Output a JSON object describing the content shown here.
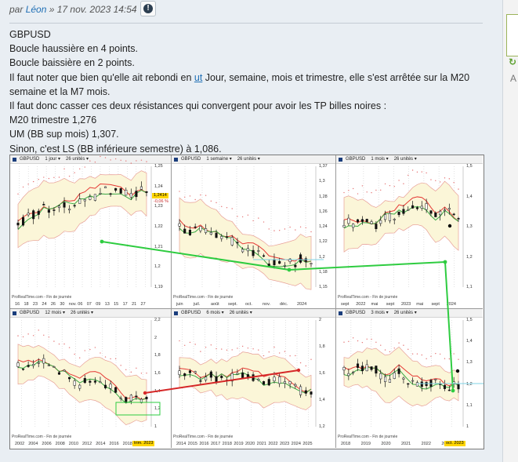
{
  "post": {
    "by": "par",
    "author": "Léon",
    "datetime": "» 17 nov. 2023 14:54",
    "report_icon": "exclamation-icon",
    "lines": {
      "l1": "GBPUSD",
      "l2": "Boucle haussière en 4 points.",
      "l3": "Boucle baissière en 2 points.",
      "l4_pre": "Il faut noter que bien qu'elle ait rebondi en ",
      "l4_link": "ut",
      "l4_post": " Jour, semaine, mois et trimestre, elle s'est arrêtée sur la M20",
      "l5": "semaine et la M7 mois.",
      "l6": "Il faut donc casser ces deux résistances qui convergent pour avoir les TP billes noires :",
      "l7": "M20 trimestre 1,276",
      "l8": "UM (BB sup mois) 1,307.",
      "l9": "Sinon, c'est LS (BB inférieure semestre) à 1,086."
    }
  },
  "charts": {
    "source": "ProRealTime.com - Fin de journée",
    "panels": [
      {
        "symbol": "GBPUSD",
        "tf": "1 jour",
        "units": "26 unités",
        "x": [
          "16",
          "18",
          "23",
          "24",
          "26",
          "30",
          "nov.",
          "06",
          "07",
          "09",
          "13",
          "15",
          "17",
          "21",
          "27"
        ],
        "y": [
          "1,25",
          "1,24",
          "1,23",
          "1,22",
          "1,21",
          "1,2",
          "1,19"
        ],
        "tag1": "1,2414",
        "tag2": "-0,06 %"
      },
      {
        "symbol": "GBPUSD",
        "tf": "1 semaine",
        "units": "26 unités",
        "x": [
          "juin",
          "juil.",
          "août",
          "sept.",
          "oct.",
          "nov.",
          "déc.",
          "2024"
        ],
        "y": [
          "1,37",
          "1,3",
          "1,28",
          "1,26",
          "1,24",
          "1,22",
          "1,2",
          "1,18",
          "1,15"
        ]
      },
      {
        "symbol": "GBPUSD",
        "tf": "1 mois",
        "units": "26 unités",
        "x": [
          "sept",
          "2022",
          "mai",
          "sept",
          "2023",
          "mai",
          "sept",
          "2024"
        ],
        "y": [
          "1,5",
          "1,4",
          "1,3",
          "1,2",
          "1,1"
        ]
      },
      {
        "symbol": "GBPUSD",
        "tf": "12 mois",
        "units": "26 unités",
        "x": [
          "2002",
          "2004",
          "2006",
          "2008",
          "2010",
          "2012",
          "2014",
          "2016",
          "2018",
          "2020"
        ],
        "y": [
          "2,2",
          "2",
          "1,8",
          "1,6",
          "1,4",
          "1,2",
          "1"
        ],
        "tag": "trim. 2023"
      },
      {
        "symbol": "GBPUSD",
        "tf": "6 mois",
        "units": "26 unités",
        "x": [
          "2014",
          "2015",
          "2016",
          "2017",
          "2018",
          "2019",
          "2020",
          "2021",
          "2022",
          "2023",
          "2024",
          "2025"
        ],
        "y": [
          "2",
          "1,8",
          "1,6",
          "1,4",
          "1,2"
        ]
      },
      {
        "symbol": "GBPUSD",
        "tf": "3 mois",
        "units": "26 unités",
        "x": [
          "2018",
          "2019",
          "2020",
          "2021",
          "2022",
          "2023"
        ],
        "y": [
          "1,5",
          "1,4",
          "1,3",
          "1,2",
          "1,1",
          "1"
        ],
        "tag": "oct. 2023"
      }
    ]
  },
  "colors": {
    "band_fill": "#fbf6d8",
    "band_line": "#e8a098",
    "ma_red": "#e53935",
    "ma_green": "#3aa845",
    "trend_green": "#2ecc40",
    "trend_red": "#d62828",
    "candle": "#111111"
  }
}
